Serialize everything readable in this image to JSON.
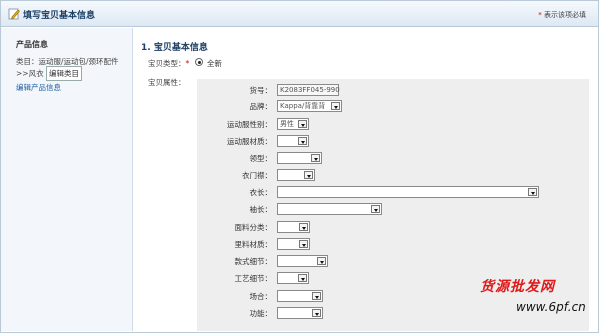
{
  "header": {
    "title": "填写宝贝基本信息",
    "required_note": "表示该项必填"
  },
  "sidebar": {
    "title": "产品信息",
    "category_line1": "类目：运动服/运动包/颈环配件",
    "category_line2": ">>风衣",
    "edit_category": "编辑类目",
    "edit_product": "编辑产品信息"
  },
  "section": {
    "title": "1. 宝贝基本信息",
    "type_label": "宝贝类型：",
    "type_option": "全新",
    "attr_label": "宝贝属性："
  },
  "attributes": [
    {
      "label": "货号：",
      "value": "K2083FF045-990",
      "kind": "text"
    },
    {
      "label": "品牌：",
      "value": "Kappa/背靠背",
      "kind": "select"
    },
    {
      "label": "运动服性别：",
      "value": "男性",
      "kind": "select"
    },
    {
      "label": "运动服材质：",
      "value": "",
      "kind": "select"
    },
    {
      "label": "领型：",
      "value": "",
      "kind": "select"
    },
    {
      "label": "衣门襟：",
      "value": "",
      "kind": "select"
    },
    {
      "label": "衣长：",
      "value": "",
      "kind": "select"
    },
    {
      "label": "袖长：",
      "value": "",
      "kind": "select"
    },
    {
      "label": "面料分类：",
      "value": "",
      "kind": "select"
    },
    {
      "label": "里料材质：",
      "value": "",
      "kind": "select"
    },
    {
      "label": "款式细节：",
      "value": "",
      "kind": "select"
    },
    {
      "label": "工艺细节：",
      "value": "",
      "kind": "select"
    },
    {
      "label": "场合：",
      "value": "",
      "kind": "select"
    },
    {
      "label": "功能：",
      "value": "",
      "kind": "select"
    }
  ],
  "watermark": {
    "text": "货源批发网",
    "url": "www.6pf.cn"
  },
  "colors": {
    "title_blue": "#1e3f66",
    "required_red": "#d40000",
    "link_blue": "#1f5fa8",
    "watermark_red": "#e01a1a"
  }
}
